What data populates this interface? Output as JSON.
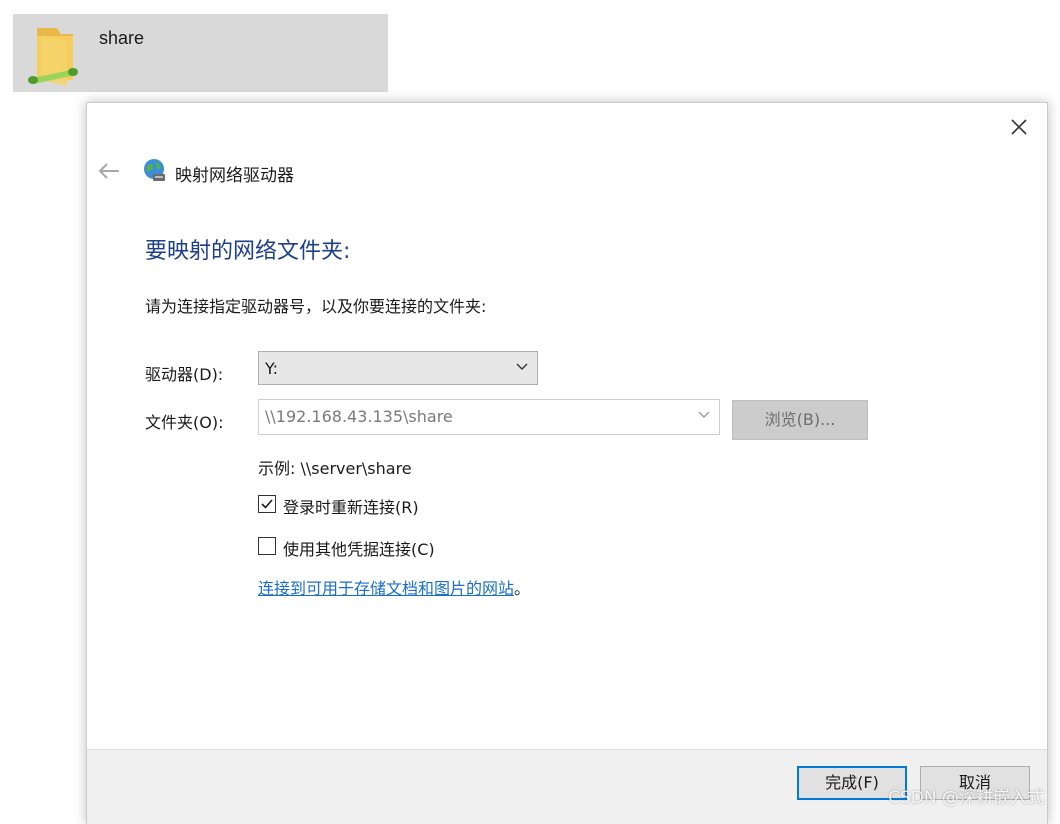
{
  "explorer": {
    "folder_name": "share",
    "folder_icon": "network-folder-icon"
  },
  "dialog": {
    "wizard_title": "映射网络驱动器",
    "heading": "要映射的网络文件夹:",
    "instruction": "请为连接指定驱动器号，以及你要连接的文件夹:",
    "drive": {
      "label": "驱动器(D):",
      "value": "Y:"
    },
    "folder": {
      "label": "文件夹(O):",
      "value": "\\\\192.168.43.135\\share"
    },
    "browse_label": "浏览(B)...",
    "example": "示例: \\\\server\\share",
    "reconnect": {
      "label": "登录时重新连接(R)",
      "checked": true
    },
    "other_credentials": {
      "label": "使用其他凭据连接(C)",
      "checked": false
    },
    "link_text": "连接到可用于存储文档和图片的网站",
    "link_suffix": "。",
    "finish_label": "完成(F)",
    "cancel_label": "取消"
  },
  "watermark": "CSDN @深耕嵌入式",
  "colors": {
    "heading": "#1d3f8a",
    "link": "#1a6fc4",
    "primary_border": "#0078d7",
    "selection_bg": "#d9d9d9"
  }
}
